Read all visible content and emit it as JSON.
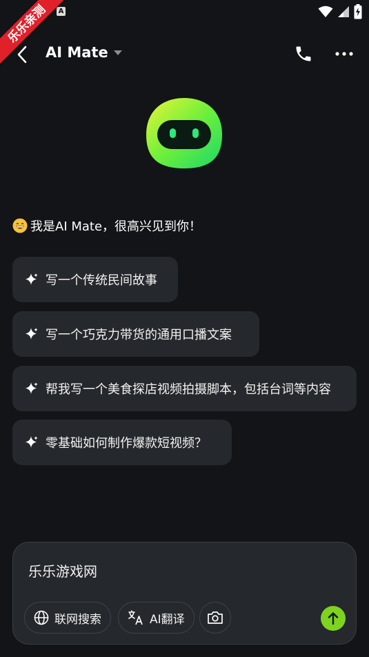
{
  "watermark": "乐乐亲测",
  "status_bar": {
    "notification_icon": "A"
  },
  "header": {
    "title": "AI Mate"
  },
  "greeting": "我是AI Mate，很高兴见到你！",
  "suggestions": [
    "写一个传统民间故事",
    "写一个巧克力带货的通用口播文案",
    "帮我写一个美食探店视频拍摄脚本，包括台词等内容",
    "零基础如何制作爆款短视频？"
  ],
  "input": {
    "value": "乐乐游戏网"
  },
  "tools": {
    "search_label": "联网搜索",
    "translate_label": "AI翻译"
  },
  "colors": {
    "background": "#121417",
    "card": "#25282c",
    "accent": "#7ed321",
    "watermark": "#e0202a"
  }
}
